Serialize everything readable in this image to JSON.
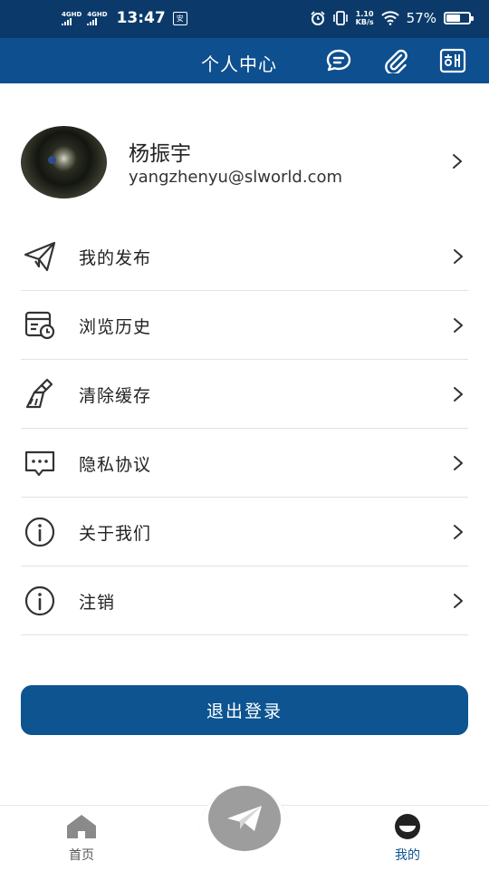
{
  "status_bar": {
    "net1": "4GHD",
    "net2": "4GHD",
    "time": "13:47",
    "tag": "安",
    "speed_value": "1.10",
    "speed_unit": "KB/s",
    "battery_text": "57%",
    "battery_level": 0.57
  },
  "appbar": {
    "title": "个人中心",
    "icons": [
      "chat-icon",
      "paperclip-icon",
      "translate-icon"
    ]
  },
  "profile": {
    "name": "杨振宇",
    "email": "yangzhenyu@slworld.com"
  },
  "menu": {
    "items": [
      {
        "label": "我的发布",
        "icon": "paper-plane-icon"
      },
      {
        "label": "浏览历史",
        "icon": "history-icon"
      },
      {
        "label": "清除缓存",
        "icon": "broom-icon"
      },
      {
        "label": "隐私协议",
        "icon": "message-dots-icon"
      },
      {
        "label": "关于我们",
        "icon": "info-icon"
      },
      {
        "label": "注销",
        "icon": "info-icon"
      }
    ]
  },
  "logout_label": "退出登录",
  "bottom_nav": {
    "home_label": "首页",
    "mine_label": "我的",
    "active_color": "#0d5491"
  },
  "colors": {
    "status_bar": "#0b3a6a",
    "app_bar": "#0d4f8f",
    "button": "#0d5491"
  }
}
